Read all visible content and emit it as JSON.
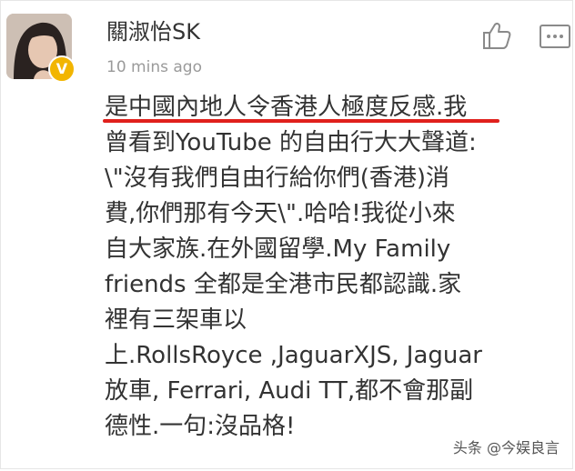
{
  "comment": {
    "username": "關淑怡SK",
    "timestamp": "10 mins ago",
    "lines": [
      "是中國內地人令香港人極度反感.我",
      "曾看到YouTube 的自由行大大聲道:",
      "\\\"沒有我們自由行給你們(香港)消",
      "費,你們那有今天\\\".哈哈!我從小來",
      "自大家族.在外國留學.My Family",
      "friends 全都是全港市民都認識.家",
      "裡有三架車以",
      "上.RollsRoyce ,JaguarXJS, Jaguar",
      "放車, Ferrari, Audi TT,都不會那副",
      "德性.一句:沒品格!"
    ],
    "highlight_color": "#e0201c"
  },
  "icons": {
    "like": "thumbs-up-icon",
    "more": "more-options-icon",
    "verified": "verified-badge-icon"
  },
  "badge": {
    "symbol": "V",
    "color": "#f2b500"
  },
  "watermark": "头条 @今娱良言"
}
